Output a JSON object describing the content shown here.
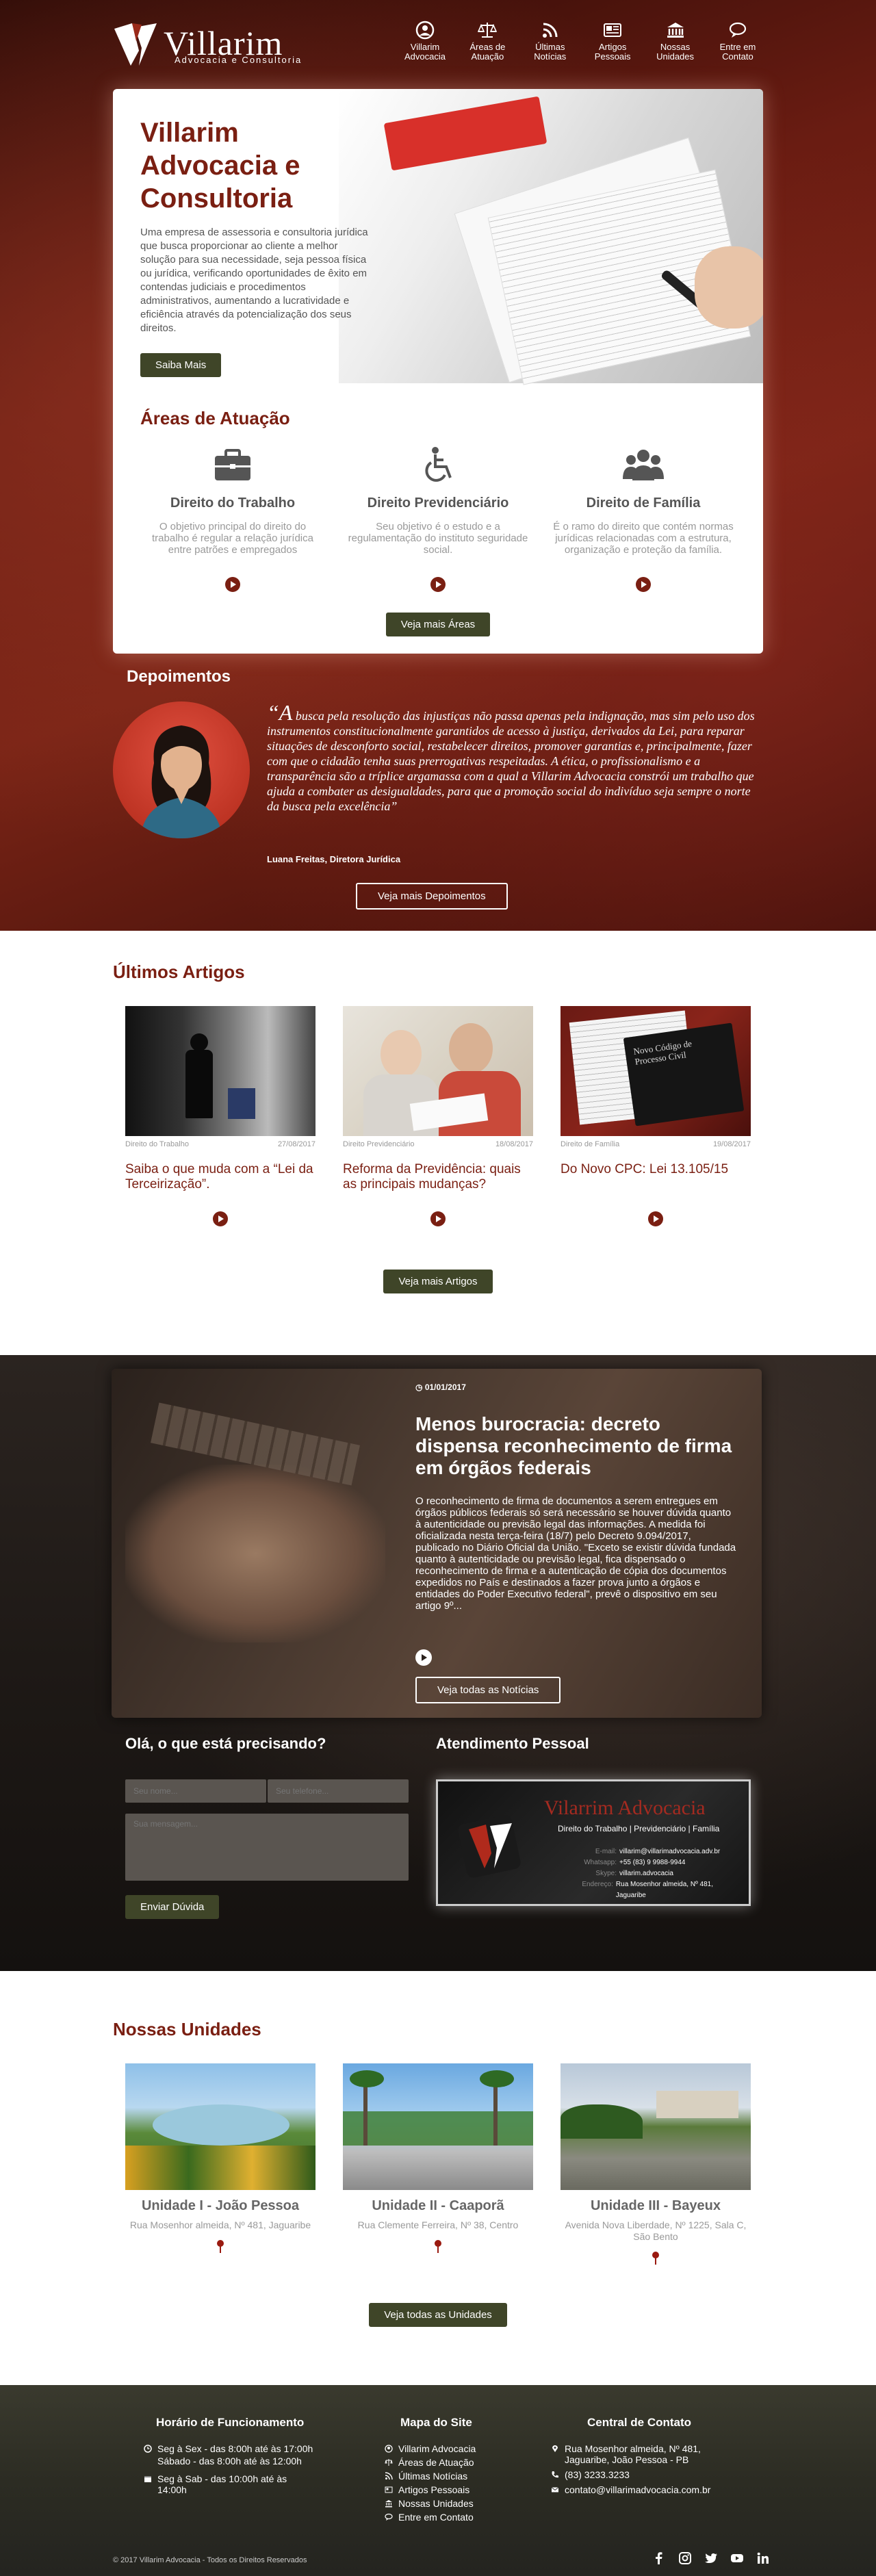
{
  "header": {
    "logo_name": "Villarim",
    "logo_sub": "Advocacia e Consultoria",
    "nav": [
      {
        "icon": "user-icon",
        "label": "Villarim Advocacia"
      },
      {
        "icon": "scales-icon",
        "label": "Áreas de Atuação"
      },
      {
        "icon": "rss-icon",
        "label": "Últimas Notícias"
      },
      {
        "icon": "newspaper-icon",
        "label": "Artigos Pessoais"
      },
      {
        "icon": "bank-icon",
        "label": "Nossas Unidades"
      },
      {
        "icon": "chat-icon",
        "label": "Entre em Contato"
      }
    ]
  },
  "hero": {
    "title": "Villarim Advocacia e Consultoria",
    "description": "Uma empresa de assessoria e consultoria jurídica que busca proporcionar ao cliente a melhor solução para sua necessidade, seja pessoa física ou jurídica, verificando oportunidades de êxito em contendas judiciais e procedimentos administrativos, aumentando a lucratividade e eficiência através da potencialização dos seus direitos.",
    "button": "Saiba Mais"
  },
  "areas": {
    "title": "Áreas de Atuação",
    "items": [
      {
        "icon": "briefcase-icon",
        "title": "Direito do Trabalho",
        "desc": "O objetivo principal do direito do trabalho é regular a relação jurídica entre patrões e empregados"
      },
      {
        "icon": "wheelchair-icon",
        "title": "Direito Previdenciário",
        "desc": "Seu objetivo é o estudo e a regulamentação do instituto seguridade social."
      },
      {
        "icon": "family-icon",
        "title": "Direito de Família",
        "desc": "É o ramo do direito que contém normas jurídicas relacionadas com a estrutura, organização e proteção da família."
      }
    ],
    "button": "Veja mais Áreas"
  },
  "depoimentos": {
    "title": "Depoimentos",
    "quote_open": "“A",
    "quote": " busca pela resolução das injustiças não passa apenas pela indignação, mas sim pelo uso dos instrumentos constitucionalmente garantidos de acesso à justiça, derivados da Lei, para reparar situações de desconforto social, restabelecer direitos, promover garantias e, principalmente, fazer com que o cidadão tenha suas prerrogativas respeitadas. A ética, o profissionalismo e a transparência são a tríplice argamassa com a qual a Villarim Advocacia constrói um trabalho que ajuda a combater as desigualdades, para que a promoção social do indivíduo seja sempre o norte da busca pela excelência”",
    "author": "Luana Freitas, Diretora Jurídica",
    "button": "Veja mais Depoimentos"
  },
  "artigos": {
    "title": "Últimos Artigos",
    "items": [
      {
        "category": "Direito do Trabalho",
        "date": "27/08/2017",
        "title": "Saiba o que muda com a “Lei da Terceirização”."
      },
      {
        "category": "Direito Previdenciário",
        "date": "18/08/2017",
        "title": "Reforma da Previdência: quais as principais mudanças?"
      },
      {
        "category": "Direito de Família",
        "date": "19/08/2017",
        "title": "Do Novo CPC: Lei 13.105/15"
      }
    ],
    "book_text": "Novo Código de Processo Civil",
    "button": "Veja mais Artigos"
  },
  "noticia": {
    "date": "01/01/2017",
    "title": "Menos burocracia: decreto dispensa reconhecimento de firma em órgãos federais",
    "body": "O reconhecimento de firma de documentos a serem entregues em órgãos públicos federais só será necessário se houver dúvida quanto à autenticidade ou previsão legal das informações. A medida foi oficializada nesta terça-feira (18/7) pelo Decreto 9.094/2017, publicado no Diário Oficial da União. \"Exceto se existir dúvida fundada quanto à autenticidade ou previsão legal, fica dispensado o reconhecimento de firma e a autenticação de cópia dos documentos expedidos no País e destinados a fazer prova junto a órgãos e entidades do Poder Executivo federal\", prevê o dispositivo em seu artigo 9º...",
    "button": "Veja todas as Notícias"
  },
  "contato": {
    "title": "Olá, o que está precisando?",
    "name_placeholder": "Seu nome...",
    "phone_placeholder": "Seu telefone...",
    "message_placeholder": "Sua mensagem...",
    "button": "Enviar Dúvida"
  },
  "atendimento": {
    "title": "Atendimento Pessoal",
    "card_name": "Vilarrim Advocacia",
    "card_spec": "Direito do Trabalho | Previdenciário | Família",
    "lines": [
      {
        "label": "E-mail:",
        "value": "villarim@villarimadvocacia.adv.br"
      },
      {
        "label": "Whatsapp:",
        "value": "+55 (83) 9 9988-9944"
      },
      {
        "label": "Skype:",
        "value": "villarim.advocacia"
      },
      {
        "label": "Endereço:",
        "value": "Rua Mosenhor almeida, Nº 481, Jaguaribe"
      }
    ]
  },
  "unidades": {
    "title": "Nossas Unidades",
    "items": [
      {
        "title": "Unidade I - João Pessoa",
        "address": "Rua Mosenhor almeida, Nº 481, Jaguaribe"
      },
      {
        "title": "Unidade II - Caaporã",
        "address": "Rua Clemente Ferreira, Nº 38, Centro"
      },
      {
        "title": "Unidade III - Bayeux",
        "address": "Avenida Nova Liberdade, Nº 1225, Sala C, São Bento"
      }
    ],
    "button": "Veja todas as Unidades"
  },
  "footer": {
    "horario_title": "Horário de Funcionamento",
    "horario": [
      "Seg à Sex - das 8:00h até às 17:00h",
      "Sábado - das 8:00h até às 12:00h",
      "Seg à Sab - das 10:00h até às 14:00h"
    ],
    "mapa_title": "Mapa do Site",
    "mapa": [
      "Villarim Advocacia",
      "Áreas de Atuação",
      "Últimas Notícias",
      "Artigos Pessoais",
      "Nossas Unidades",
      "Entre em Contato"
    ],
    "central_title": "Central de Contato",
    "endereco": "Rua Mosenhor almeida, Nº 481, Jaguaribe, João Pessoa - PB",
    "telefone": "(83) 3233.3233",
    "email": "contato@villarimadvocacia.com.br",
    "copyright": "© 2017 Villarim Advocacia - Todos os Direitos Reservados"
  },
  "colors": {
    "brand": "#7a1f12",
    "button": "#3f4528"
  }
}
